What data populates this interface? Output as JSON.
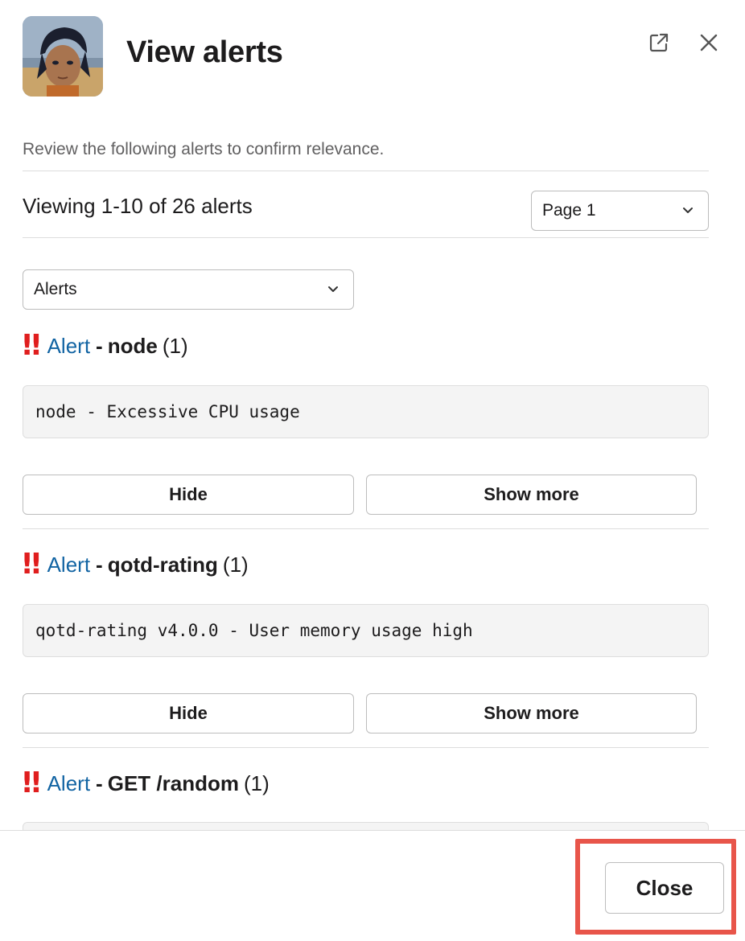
{
  "header": {
    "title": "View alerts",
    "avatar": "avatar-image",
    "actions": {
      "external_icon": "external-link-icon",
      "close_icon": "close-icon"
    }
  },
  "subtitle": "Review the following alerts to confirm relevance.",
  "pagination": {
    "summary": "Viewing 1-10 of 26 alerts",
    "page_select": "Page 1"
  },
  "filter": {
    "selected": "Alerts"
  },
  "alerts": [
    {
      "marker": "‼",
      "link": "Alert",
      "separator": "-",
      "name": "node",
      "count": "(1)",
      "message": "node - Excessive CPU usage",
      "hide_label": "Hide",
      "more_label": "Show more"
    },
    {
      "marker": "‼",
      "link": "Alert",
      "separator": "-",
      "name": "qotd-rating",
      "count": "(1)",
      "message": "qotd-rating v4.0.0 - User memory usage high",
      "hide_label": "Hide",
      "more_label": "Show more"
    },
    {
      "marker": "‼",
      "link": "Alert",
      "separator": "-",
      "name": "GET /random",
      "count": "(1)",
      "message": ""
    }
  ],
  "footer": {
    "close_label": "Close"
  },
  "colors": {
    "alert_red": "#e01e1e",
    "link_blue": "#1264a3",
    "highlight": "#e8554a"
  }
}
